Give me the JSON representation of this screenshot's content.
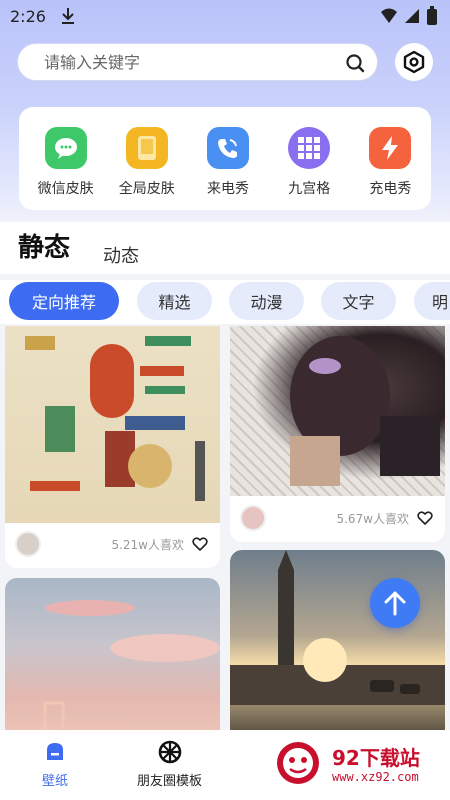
{
  "status_bar": {
    "time": "2:26"
  },
  "search": {
    "placeholder": "请输入关键字",
    "value": ""
  },
  "features": [
    {
      "label": "微信皮肤",
      "icon": "chat-icon",
      "color": "#3ec86a"
    },
    {
      "label": "全局皮肤",
      "icon": "phone-skin-icon",
      "color": "#f5b623"
    },
    {
      "label": "来电秀",
      "icon": "phone-call-icon",
      "color": "#4a8ff2"
    },
    {
      "label": "九宫格",
      "icon": "grid-icon",
      "color": "#8a6ef0"
    },
    {
      "label": "充电秀",
      "icon": "lightning-icon",
      "color": "#f4623e"
    }
  ],
  "section_tabs": {
    "static": "静态",
    "dynamic": "动态"
  },
  "chips": [
    "定向推荐",
    "精选",
    "动漫",
    "文字",
    "明"
  ],
  "cards": [
    {
      "likes": "5.21w人喜欢"
    },
    {
      "likes": "5.67w人喜欢"
    }
  ],
  "bottom_nav": [
    {
      "label": "壁纸",
      "icon": "wallpaper-icon",
      "active": true
    },
    {
      "label": "朋友圈模板",
      "icon": "aperture-icon",
      "active": false
    }
  ],
  "watermark": {
    "title": "92下载站",
    "url": "www.xz92.com"
  },
  "colors": {
    "accent": "#3d6cf2",
    "chip_bg": "#e6ebfc"
  }
}
